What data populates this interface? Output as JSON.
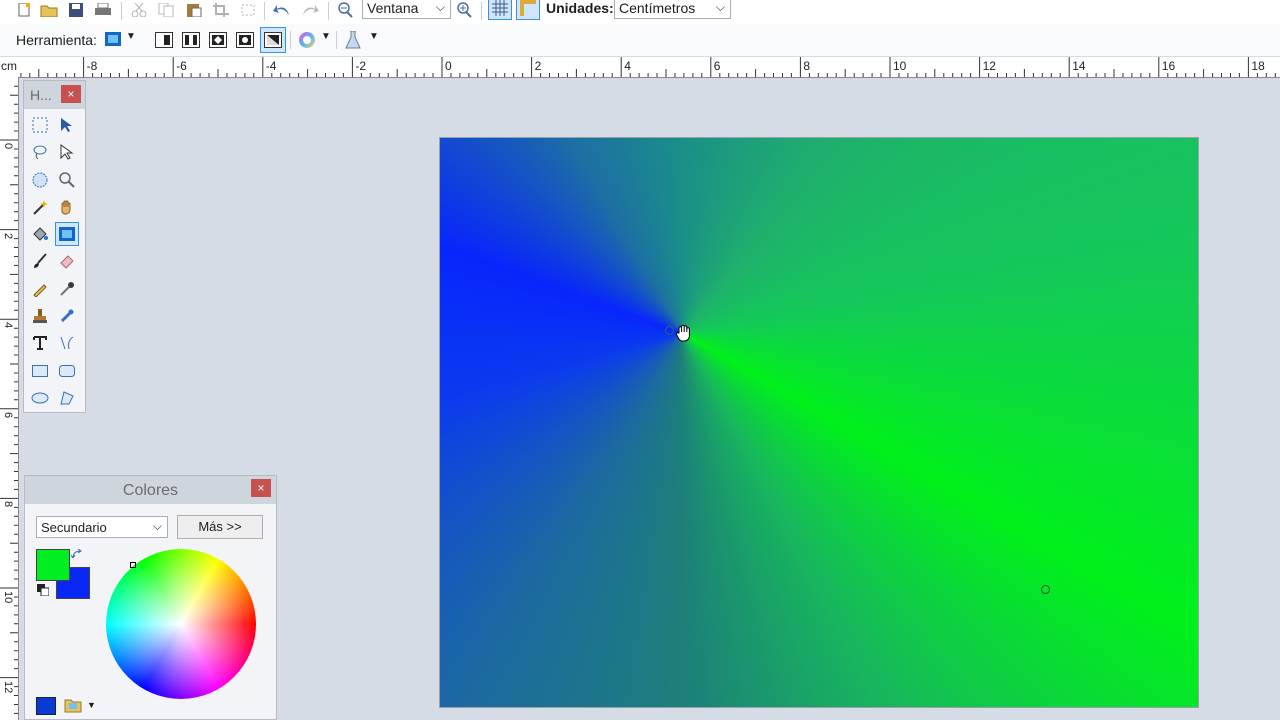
{
  "toolbar": {
    "zoom_value": "Ventana",
    "units_label": "Unidades:",
    "units_value": "Centímetros"
  },
  "toolbar2": {
    "tool_label": "Herramienta:"
  },
  "ruler": {
    "unit": "cm",
    "labels": [
      "-8",
      "-6",
      "-4",
      "-2",
      "0",
      "2",
      "4",
      "6",
      "8",
      "10",
      "12",
      "14",
      "16",
      "18"
    ],
    "vertical_labels": [
      "0",
      "2",
      "4",
      "6",
      "8",
      "10",
      "12"
    ]
  },
  "tools_panel": {
    "title": "H...",
    "close": "×"
  },
  "colors_panel": {
    "title": "Colores",
    "close": "×",
    "mode_value": "Secundario",
    "more_label": "Más >>",
    "primary_color": "#00ee22",
    "secondary_color": "#0a28f5"
  },
  "canvas": {
    "gradient_colors": [
      "#0826fc",
      "#00f11b"
    ]
  }
}
